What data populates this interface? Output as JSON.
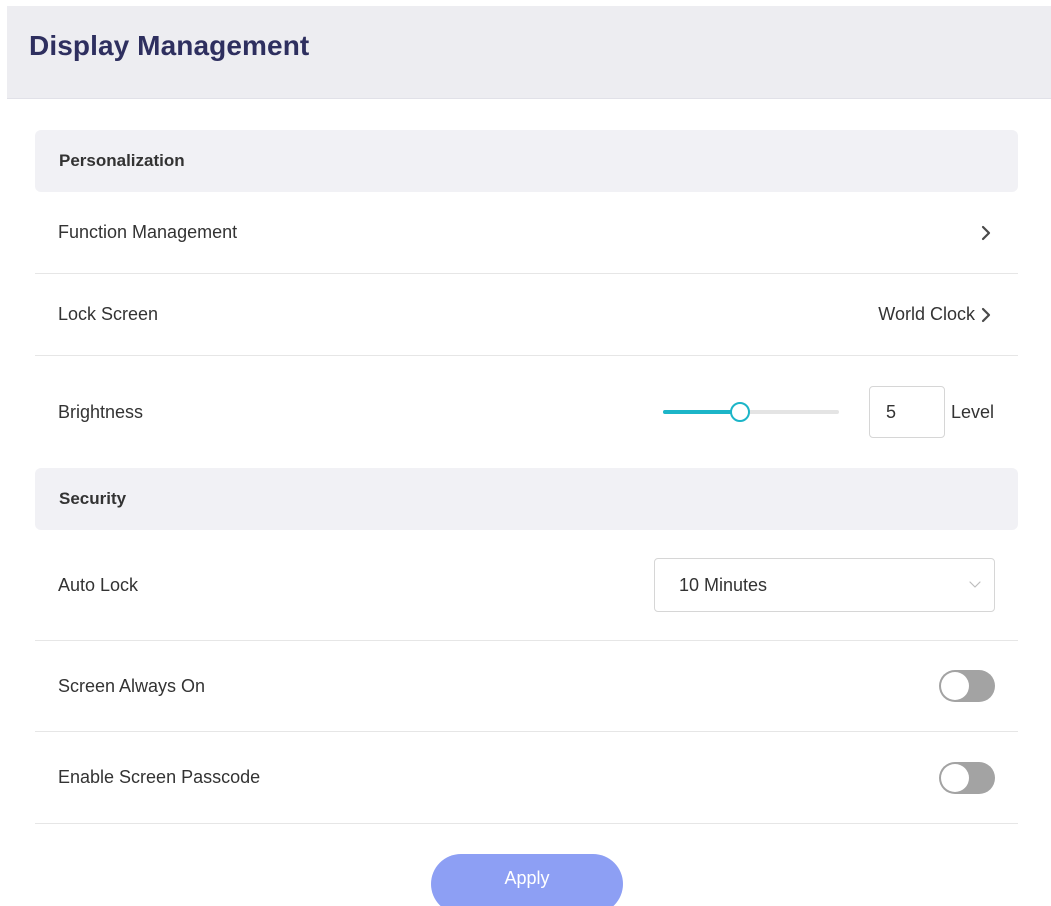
{
  "header": {
    "title": "Display Management"
  },
  "sections": {
    "personalization": {
      "title": "Personalization",
      "function_management": {
        "label": "Function Management",
        "icon": "chevron-right-icon"
      },
      "lock_screen": {
        "label": "Lock Screen",
        "value": "World Clock",
        "icon": "chevron-right-icon"
      },
      "brightness": {
        "label": "Brightness",
        "value": "5",
        "unit": "Level",
        "slider_fraction": 0.44
      }
    },
    "security": {
      "title": "Security",
      "auto_lock": {
        "label": "Auto Lock",
        "value": "10 Minutes",
        "icon": "chevron-down-icon"
      },
      "screen_always_on": {
        "label": "Screen Always On",
        "enabled": false
      },
      "screen_passcode": {
        "label": "Enable Screen Passcode",
        "enabled": false
      }
    }
  },
  "footer": {
    "apply_label": "Apply"
  },
  "colors": {
    "title": "#2e2f5f",
    "accent": "#1cb5c8",
    "button": "#8d9ff4",
    "toggle_off": "#a3a3a3"
  }
}
